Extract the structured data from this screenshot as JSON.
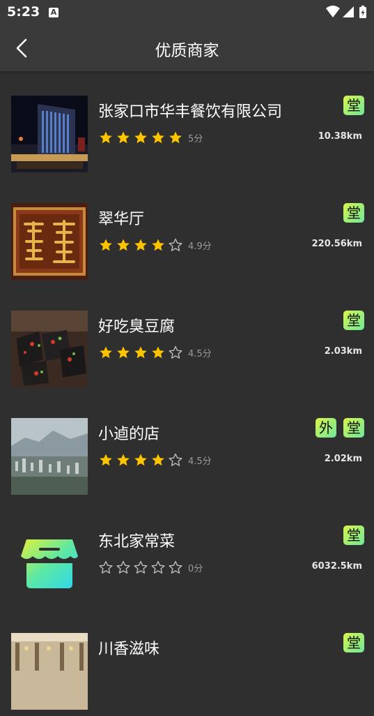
{
  "status_bar": {
    "time": "5:23",
    "notification_icon": "A"
  },
  "header": {
    "title": "优质商家"
  },
  "icons": {
    "back": "chevron-left-icon",
    "star_filled": "star-filled-icon",
    "star_empty": "star-outline-icon"
  },
  "colors": {
    "star": "#ffc400",
    "badge_from": "#d9f54a",
    "badge_to": "#6ee89a",
    "background": "#2f2f2f"
  },
  "merchants": [
    {
      "name": "张家口市华丰餐饮有限公司",
      "rating": 5,
      "score": "5分",
      "distance": "10.38km",
      "badges": [
        "堂"
      ],
      "image": "hotel-building-night"
    },
    {
      "name": "翠华厅",
      "rating": 4,
      "score": "4.9分",
      "distance": "220.56km",
      "badges": [
        "堂"
      ],
      "image": "wooden-signboard"
    },
    {
      "name": "好吃臭豆腐",
      "rating": 4,
      "score": "4.5分",
      "distance": "2.03km",
      "badges": [
        "堂"
      ],
      "image": "stinky-tofu-dish"
    },
    {
      "name": "小逌的店",
      "rating": 4,
      "score": "4.5分",
      "distance": "2.02km",
      "badges": [
        "外",
        "堂"
      ],
      "image": "city-aerial-view"
    },
    {
      "name": "东北家常菜",
      "rating": 0,
      "score": "0分",
      "distance": "6032.5km",
      "badges": [
        "堂"
      ],
      "image": "shop-placeholder-icon"
    },
    {
      "name": "川香滋味",
      "rating": 0,
      "score": "",
      "distance": "",
      "badges": [
        "堂"
      ],
      "image": "restaurant-interior"
    }
  ]
}
